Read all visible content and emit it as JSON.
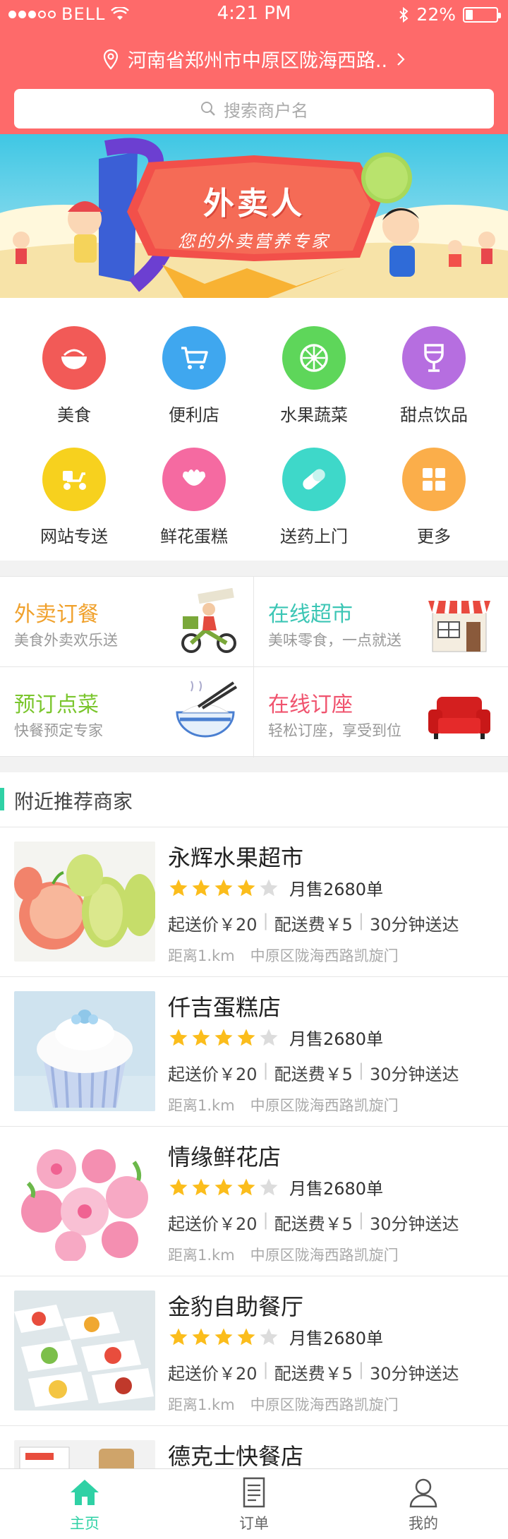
{
  "status_bar": {
    "carrier": "BELL",
    "time": "4:21 PM",
    "battery": "22%",
    "battery_level": 0.22
  },
  "header": {
    "location": "河南省郑州市中原区陇海西路..",
    "search_placeholder": "搜索商户名"
  },
  "banner": {
    "title": "外卖人",
    "subtitle": "您的外卖营养专家"
  },
  "categories": [
    {
      "label": "美食",
      "icon": "bowl-icon",
      "color": "#f25a57"
    },
    {
      "label": "便利店",
      "icon": "cart-icon",
      "color": "#3fa7ef"
    },
    {
      "label": "水果蔬菜",
      "icon": "fruit-icon",
      "color": "#5ed65a"
    },
    {
      "label": "甜点饮品",
      "icon": "wine-glass-icon",
      "color": "#b66ee0"
    },
    {
      "label": "网站专送",
      "icon": "scooter-icon",
      "color": "#f7d11e"
    },
    {
      "label": "鲜花蛋糕",
      "icon": "flower-icon",
      "color": "#f56aa1"
    },
    {
      "label": "送药上门",
      "icon": "pill-icon",
      "color": "#3ed8c9"
    },
    {
      "label": "更多",
      "icon": "grid-icon",
      "color": "#fbae4a"
    }
  ],
  "services": [
    {
      "title": "外卖订餐",
      "desc": "美食外卖欢乐送",
      "color": "#f0a12c",
      "icon": "delivery-rider-icon"
    },
    {
      "title": "在线超市",
      "desc": "美味零食，一点就送",
      "color": "#3cc6b5",
      "icon": "shop-front-icon"
    },
    {
      "title": "预订点菜",
      "desc": "快餐预定专家",
      "color": "#7bc62e",
      "icon": "rice-bowl-icon"
    },
    {
      "title": "在线订座",
      "desc": "轻松订座，享受到位",
      "color": "#f0536e",
      "icon": "sofa-icon"
    }
  ],
  "nearby": {
    "title": "附近推荐商家",
    "shops": [
      {
        "name": "永辉水果超市",
        "rating": 4,
        "sales": "月售2680单",
        "min_price": "起送价￥20",
        "delivery_fee": "配送费￥5",
        "eta": "30分钟送达",
        "distance": "距离1.km",
        "address": "中原区陇海西路凯旋门",
        "image": "fruit-photo"
      },
      {
        "name": "仟吉蛋糕店",
        "rating": 4,
        "sales": "月售2680单",
        "min_price": "起送价￥20",
        "delivery_fee": "配送费￥5",
        "eta": "30分钟送达",
        "distance": "距离1.km",
        "address": "中原区陇海西路凯旋门",
        "image": "cupcake-photo"
      },
      {
        "name": "情缘鲜花店",
        "rating": 4,
        "sales": "月售2680单",
        "min_price": "起送价￥20",
        "delivery_fee": "配送费￥5",
        "eta": "30分钟送达",
        "distance": "距离1.km",
        "address": "中原区陇海西路凯旋门",
        "image": "flowers-photo"
      },
      {
        "name": "金豹自助餐厅",
        "rating": 4,
        "sales": "月售2680单",
        "min_price": "起送价￥20",
        "delivery_fee": "配送费￥5",
        "eta": "30分钟送达",
        "distance": "距离1.km",
        "address": "中原区陇海西路凯旋门",
        "image": "buffet-photo"
      },
      {
        "name": "德克士快餐店",
        "image": "fastfood-photo"
      }
    ]
  },
  "tabbar": [
    {
      "label": "主页",
      "icon": "home-icon",
      "active": true
    },
    {
      "label": "订单",
      "icon": "order-list-icon",
      "active": false
    },
    {
      "label": "我的",
      "icon": "user-icon",
      "active": false
    }
  ]
}
